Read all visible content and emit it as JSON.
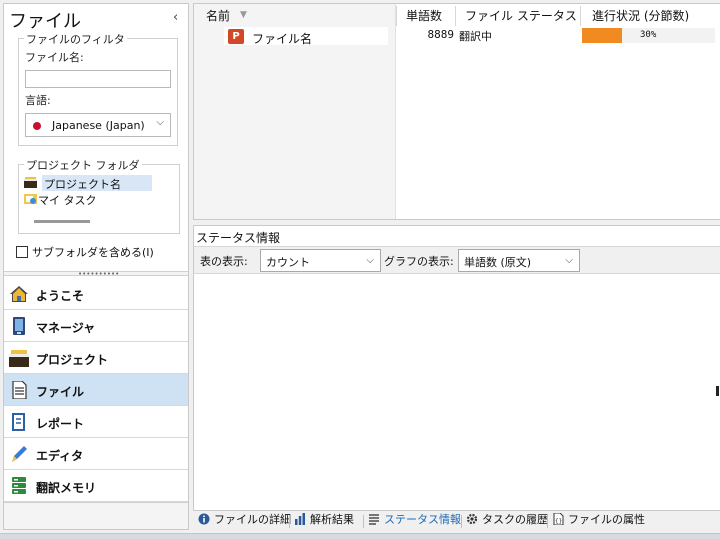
{
  "left_panel": {
    "title": "ファイル",
    "collapse_icon": "chevron-left-icon",
    "filter": {
      "legend": "ファイルのフィルタ",
      "filename_label": "ファイル名:",
      "filename_value": "",
      "language_label": "言語:",
      "language_value": "Japanese (Japan)"
    },
    "project_folder": {
      "legend": "プロジェクト フォルダ",
      "items": [
        {
          "label": "プロジェクト名",
          "icon": "project-folder-icon",
          "selected": true
        },
        {
          "label": "マイ タスク",
          "icon": "task-folder-icon",
          "selected": false
        }
      ]
    },
    "subfolder_checkbox": {
      "label": "サブフォルダを含める(I)",
      "checked": false
    },
    "nav": [
      {
        "label": "ようこそ",
        "icon": "home-icon",
        "active": false
      },
      {
        "label": "マネージャ",
        "icon": "manager-icon",
        "active": false
      },
      {
        "label": "プロジェクト",
        "icon": "project-icon",
        "active": false
      },
      {
        "label": "ファイル",
        "icon": "file-icon",
        "active": true
      },
      {
        "label": "レポート",
        "icon": "report-icon",
        "active": false
      },
      {
        "label": "エディタ",
        "icon": "editor-icon",
        "active": false
      },
      {
        "label": "翻訳メモリ",
        "icon": "translation-memory-icon",
        "active": false
      }
    ]
  },
  "file_table": {
    "headers": {
      "name": "名前",
      "words": "単語数",
      "status": "ファイル ステータス",
      "progress": "進行状況 (分節数)"
    },
    "rows": [
      {
        "icon": "powerpoint-file-icon",
        "icon_glyph": "P",
        "name": "ファイル名",
        "words": "8889",
        "status": "翻訳中",
        "progress_text": "30%",
        "progress_fraction": 0.3
      }
    ],
    "progress_color": "#f28a22"
  },
  "status_info": {
    "title": "ステータス情報",
    "table_display_label": "表の表示:",
    "table_display_value": "カウント",
    "graph_display_label": "グラフの表示:",
    "graph_display_value": "単語数 (原文)"
  },
  "bottom_tabs": [
    {
      "label": "ファイルの詳細",
      "icon": "info-icon",
      "active": false
    },
    {
      "label": "解析結果",
      "icon": "analysis-icon",
      "active": false
    },
    {
      "label": "ステータス情報",
      "icon": "status-list-icon",
      "active": true
    },
    {
      "label": "タスクの履歴",
      "icon": "gear-icon",
      "active": false
    },
    {
      "label": "ファイルの属性",
      "icon": "file-properties-icon",
      "active": false
    }
  ]
}
